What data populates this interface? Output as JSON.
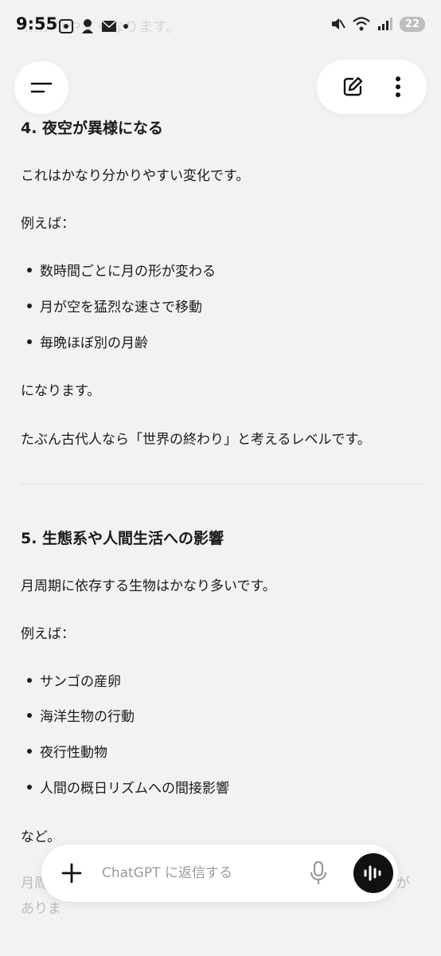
{
  "status_bar": {
    "time": "9:55",
    "faded_text": "…かりやすくなります。",
    "battery": "22",
    "icons": [
      "screenshot-icon",
      "app-icon",
      "mail-icon",
      "dot-icon",
      "mute-icon",
      "wifi-icon",
      "signal-icon"
    ]
  },
  "header": {
    "menu_icon": "menu-icon",
    "new_chat_icon": "edit-icon",
    "more_icon": "more-vertical-icon"
  },
  "section4": {
    "title": "4. 夜空が異様になる",
    "intro": "これはかなり分かりやすい変化です。",
    "examples_label": "例えば：",
    "bullets": [
      "数時間ごとに月の形が変わる",
      "月が空を猛烈な速さで移動",
      "毎晩ほぼ別の月齢"
    ],
    "after": "になります。",
    "conclusion": "たぶん古代人なら「世界の終わり」と考えるレベルです。"
  },
  "section5": {
    "title": "5. 生態系や人間生活への影響",
    "intro": "月周期に依存する生物はかなり多いです。",
    "examples_label": "例えば：",
    "bullets": [
      "サンゴの産卵",
      "海洋生物の行動",
      "夜行性動物",
      "人間の概日リズムへの間接影響"
    ],
    "after": "など。",
    "faded_line1_left": "月周",
    "faded_line1_right": "が",
    "faded_line2": "ありま"
  },
  "composer": {
    "placeholder": "ChatGPT に返信する",
    "plus_icon": "plus-icon",
    "mic_icon": "mic-icon",
    "voice_icon": "voice-mode-icon"
  }
}
